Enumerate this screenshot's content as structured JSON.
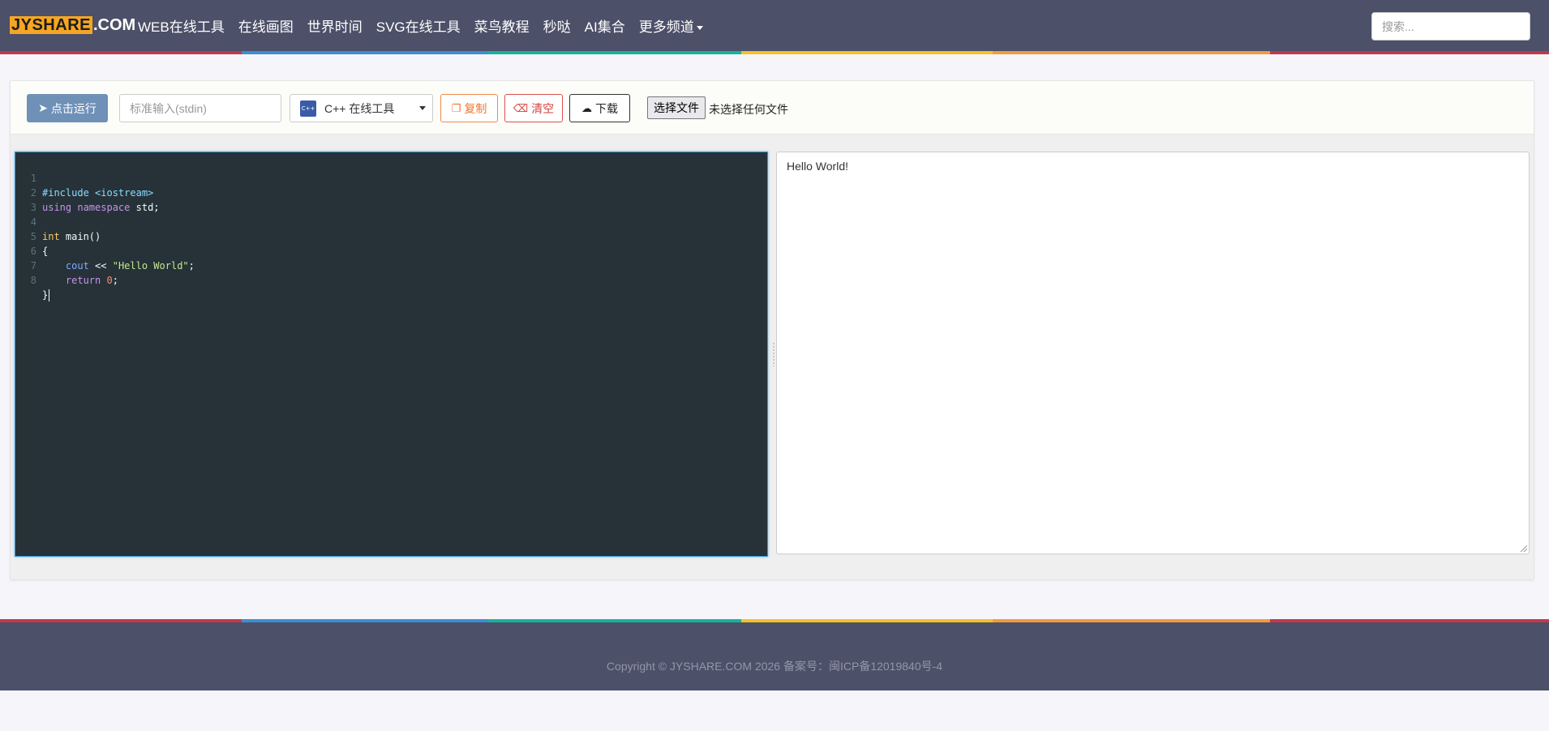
{
  "header": {
    "logo_main": "JYSHARE",
    "logo_suffix": ".COM",
    "nav": [
      {
        "label": "WEB在线工具"
      },
      {
        "label": "在线画图"
      },
      {
        "label": "世界时间"
      },
      {
        "label": "SVG在线工具"
      },
      {
        "label": "菜鸟教程"
      },
      {
        "label": "秒哒"
      },
      {
        "label": "AI集合"
      },
      {
        "label": "更多频道"
      }
    ],
    "search_placeholder": "搜索..."
  },
  "toolbar": {
    "run_label": "点击运行",
    "stdin_placeholder": "标准输入(stdin)",
    "language": {
      "icon_text": "C++",
      "label": "C++ 在线工具"
    },
    "copy_label": "复制",
    "clear_label": "清空",
    "download_label": "下载",
    "file_button": "选择文件",
    "file_status": "未选择任何文件"
  },
  "editor": {
    "line_numbers": [
      "1",
      "2",
      "3",
      "4",
      "5",
      "6",
      "7",
      "8"
    ],
    "tokens": {
      "l1_include": "#include <iostream>",
      "l2_using": "using",
      "l2_namespace": "namespace",
      "l2_rest": " std;",
      "l4_int": "int",
      "l4_main": " main()",
      "l5_brace": "{",
      "l6_cout": "cout",
      "l6_op": " << ",
      "l6_str": "\"Hello World\"",
      "l6_semi": ";",
      "l7_return": "return",
      "l7_zero": "0",
      "l7_semi": ";",
      "l8_brace": "}"
    }
  },
  "output": {
    "text": "Hello World!"
  },
  "footer": {
    "copyright": "Copyright © JYSHARE.COM 2026 备案号：闽ICP备12019840号-4"
  },
  "colors": {
    "navbar_bg": "#4c5068",
    "rainbow": [
      "#c0394b",
      "#3c8ed2",
      "#16b39b",
      "#f3c324",
      "#f39a3c",
      "#c0394b"
    ],
    "editor_bg": "#263238",
    "run_button": "#6f91b8"
  }
}
